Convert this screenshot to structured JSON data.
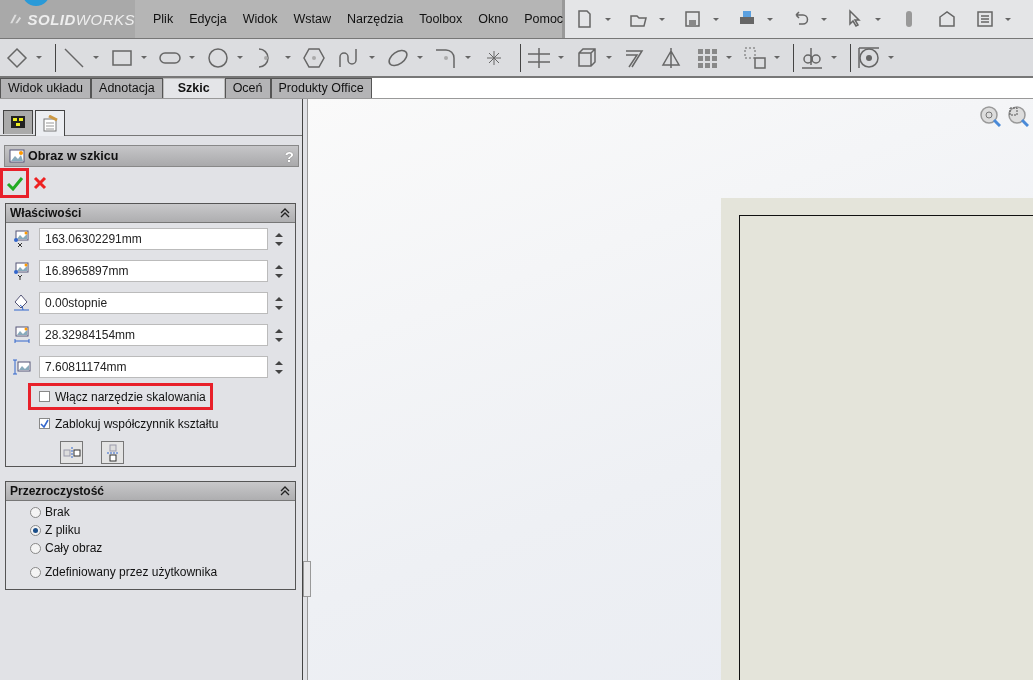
{
  "app": {
    "logo_prefix": "SOLID",
    "logo_suffix": "WORKS"
  },
  "menu": [
    "Plik",
    "Edycja",
    "Widok",
    "Wstaw",
    "Narzędzia",
    "Toolbox",
    "Okno",
    "Pomoc"
  ],
  "tabs": [
    {
      "label": "Widok układu",
      "selected": false
    },
    {
      "label": "Adnotacja",
      "selected": false
    },
    {
      "label": "Szkic",
      "selected": true
    },
    {
      "label": "Oceń",
      "selected": false
    },
    {
      "label": "Produkty Office",
      "selected": false
    }
  ],
  "panel_tabs": [
    {
      "kind": "tree",
      "selected": false
    },
    {
      "kind": "properties",
      "selected": true
    }
  ],
  "property_manager": {
    "title": "Obraz w szkicu",
    "help": "?",
    "confirm_highlighted": true
  },
  "properties": {
    "title": "Właściwości",
    "fields": [
      {
        "kind": "x",
        "value": "163.06302291mm"
      },
      {
        "kind": "y",
        "value": "16.8965897mm"
      },
      {
        "kind": "angle",
        "value": "0.00stopnie"
      },
      {
        "kind": "width",
        "value": "28.32984154mm"
      },
      {
        "kind": "height",
        "value": "7.60811174mm"
      }
    ],
    "checkboxes": [
      {
        "label": "Włącz narzędzie skalowania",
        "checked": false,
        "highlighted": true
      },
      {
        "label": "Zablokuj współczynnik kształtu",
        "checked": true,
        "highlighted": false
      }
    ]
  },
  "transparency": {
    "title": "Przezroczystość",
    "options": [
      {
        "label": "Brak",
        "selected": false
      },
      {
        "label": "Z pliku",
        "selected": true
      },
      {
        "label": "Cały obraz",
        "selected": false
      },
      {
        "label": "Zdefiniowany przez użytkownika",
        "selected": false
      }
    ]
  }
}
